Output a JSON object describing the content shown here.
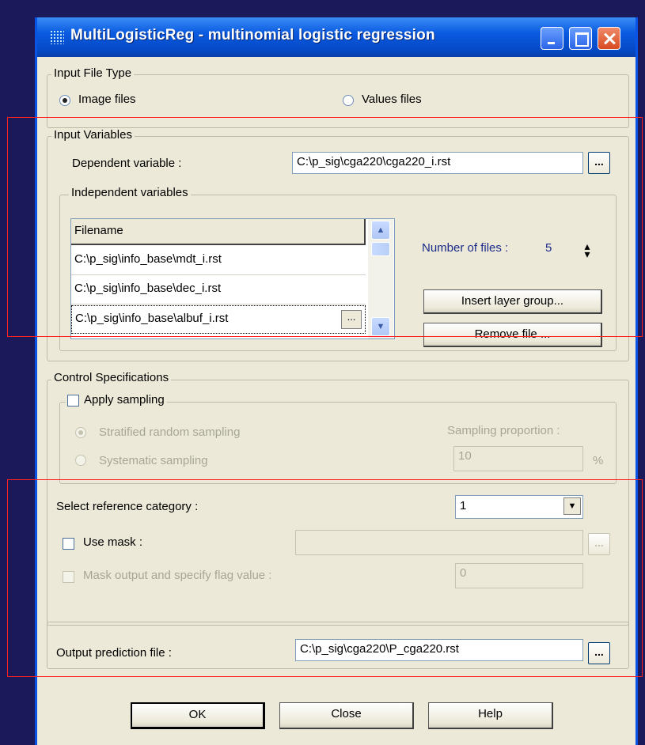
{
  "window": {
    "title": "MultiLogisticReg - multinomial logistic regression"
  },
  "input_file_type": {
    "label": "Input File Type",
    "image_files": "Image files",
    "values_files": "Values files",
    "selected": "Image files"
  },
  "input_variables": {
    "label": "Input Variables",
    "dependent_label": "Dependent variable :",
    "dependent_value": "C:\\p_sig\\cga220\\cga220_i.rst",
    "browse": "...",
    "independent": {
      "label": "Independent variables",
      "header": "Filename",
      "files": [
        "C:\\p_sig\\info_base\\mdt_i.rst",
        "C:\\p_sig\\info_base\\dec_i.rst",
        "C:\\p_sig\\info_base\\albuf_i.rst"
      ],
      "row_browse": "...",
      "number_label": "Number of files :",
      "number_value": "5",
      "insert_button": "Insert layer group...",
      "remove_button": "Remove file ..."
    }
  },
  "control": {
    "label": "Control Specifications",
    "apply_sampling": "Apply sampling",
    "stratified": "Stratified random sampling",
    "systematic": "Systematic sampling",
    "proportion_label": "Sampling proportion :",
    "proportion_value": "10",
    "percent": "%"
  },
  "reference": {
    "label": "Select reference category :",
    "value": "1"
  },
  "mask": {
    "use_mask": "Use mask :",
    "mask_value": "",
    "browse": "...",
    "mask_output": "Mask output and specify flag value :",
    "flag_value": "0"
  },
  "output": {
    "label": "Output prediction file :",
    "value": "C:\\p_sig\\cga220\\P_cga220.rst",
    "browse": "..."
  },
  "buttons": {
    "ok": "OK",
    "close": "Close",
    "help": "Help"
  },
  "colors": {
    "desktop": "#1b1959",
    "dialog": "#ece9d8",
    "titlebar": "#0a5ae0",
    "highlight_box": "#ff2020",
    "count_text": "#1a2a8a"
  }
}
